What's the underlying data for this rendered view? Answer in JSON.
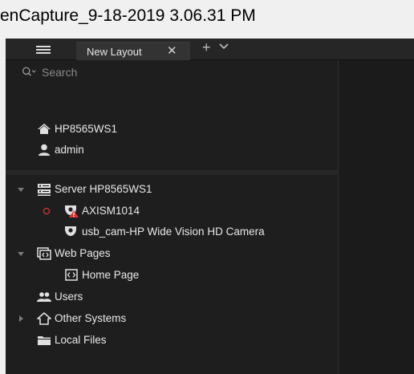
{
  "window": {
    "title": "enCapture_9-18-2019 3.06.31 PM"
  },
  "tabbar": {
    "menu_icon": "hamburger-icon",
    "tab_label": "New Layout",
    "close_glyph": "✕",
    "add_glyph": "+",
    "dropdown_glyph": "⌄"
  },
  "search": {
    "placeholder": "Search",
    "icon": "search-icon"
  },
  "user_info": {
    "host": "HP8565WS1",
    "user": "admin"
  },
  "tree": {
    "server": {
      "label": "Server HP8565WS1",
      "expanded": true,
      "cameras": [
        {
          "label": "AXISM1014",
          "status": "offline"
        },
        {
          "label": "usb_cam-HP Wide Vision HD Camera",
          "status": "online"
        }
      ]
    },
    "web_pages": {
      "label": "Web Pages",
      "expanded": true,
      "children": [
        {
          "label": "Home Page"
        }
      ]
    },
    "users": {
      "label": "Users"
    },
    "other_systems": {
      "label": "Other Systems",
      "expanded": false
    },
    "local_files": {
      "label": "Local Files"
    }
  },
  "colors": {
    "panel_bg": "#1e1e1e",
    "text": "#e8e8e8",
    "alert_red": "#e03131",
    "offline_ring": "#c83232"
  }
}
